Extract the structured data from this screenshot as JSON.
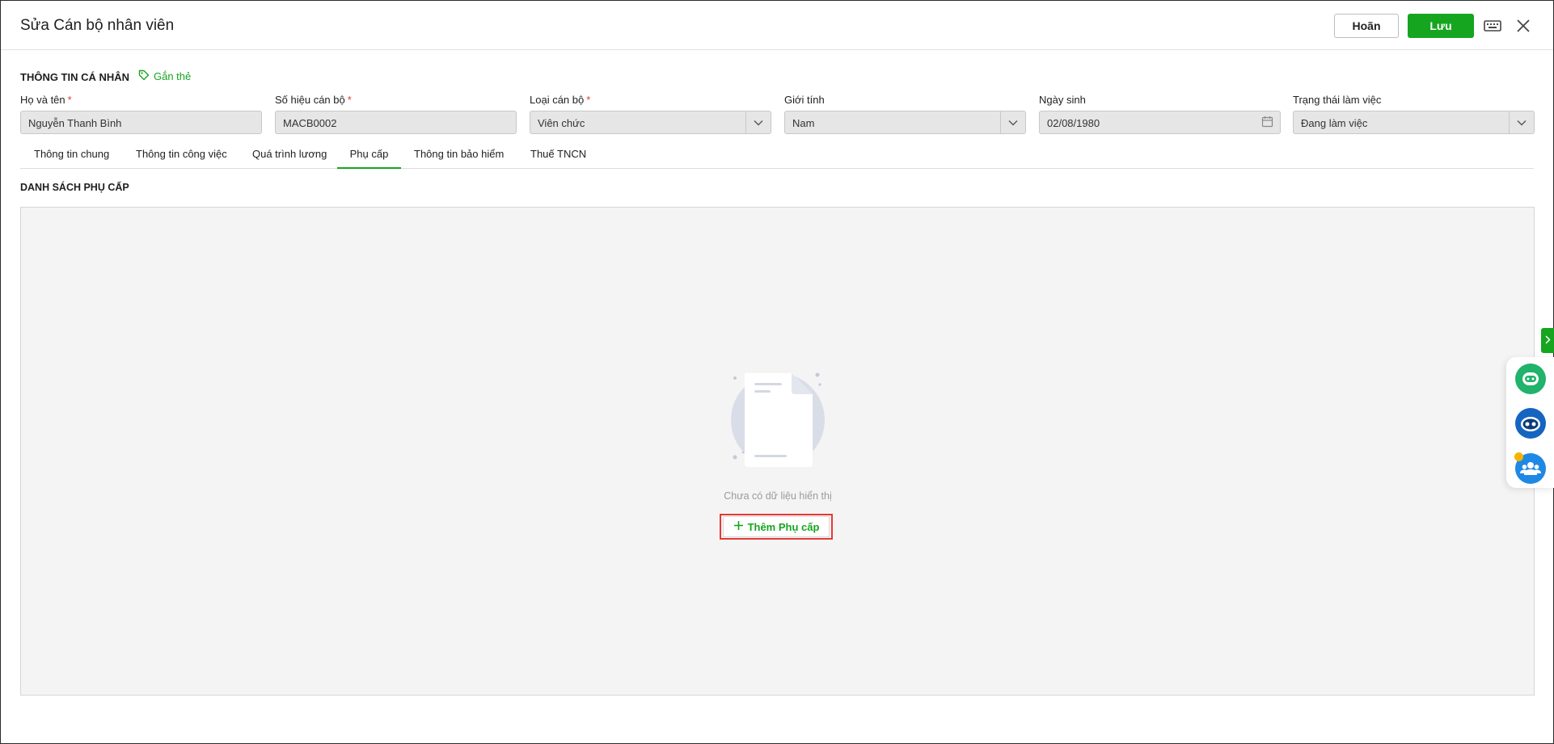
{
  "header": {
    "title": "Sửa Cán bộ nhân viên",
    "cancel_label": "Hoãn",
    "save_label": "Lưu"
  },
  "personal_info": {
    "section_title": "THÔNG TIN CÁ NHÂN",
    "tag_label": "Gắn thẻ",
    "fields": {
      "full_name": {
        "label": "Họ và tên",
        "required": "*",
        "value": "Nguyễn Thanh Bình"
      },
      "staff_code": {
        "label": "Số hiệu cán bộ",
        "required": "*",
        "value": "MACB0002"
      },
      "staff_type": {
        "label": "Loại cán bộ",
        "required": "*",
        "value": "Viên chức"
      },
      "gender": {
        "label": "Giới tính",
        "value": "Nam"
      },
      "birth_date": {
        "label": "Ngày sinh",
        "value": "02/08/1980"
      },
      "work_status": {
        "label": "Trạng thái làm việc",
        "value": "Đang làm việc"
      }
    }
  },
  "tabs": [
    {
      "label": "Thông tin chung"
    },
    {
      "label": "Thông tin công việc"
    },
    {
      "label": "Quá trình lương"
    },
    {
      "label": "Phụ cấp",
      "active": true
    },
    {
      "label": "Thông tin bảo hiểm"
    },
    {
      "label": "Thuế TNCN"
    }
  ],
  "allowance": {
    "list_title": "DANH SÁCH PHỤ CẤP",
    "empty_text": "Chưa có dữ liệu hiển thị",
    "add_label": "Thêm Phụ cấp"
  },
  "colors": {
    "accent": "#15a51f",
    "required": "#e53935",
    "highlight": "#e53935"
  },
  "icons": [
    "keyboard-icon",
    "close-icon",
    "tag-icon",
    "chevron-down-icon",
    "calendar-icon",
    "plus-icon",
    "chevron-right-icon",
    "chat-icon",
    "robot-icon",
    "group-icon"
  ]
}
